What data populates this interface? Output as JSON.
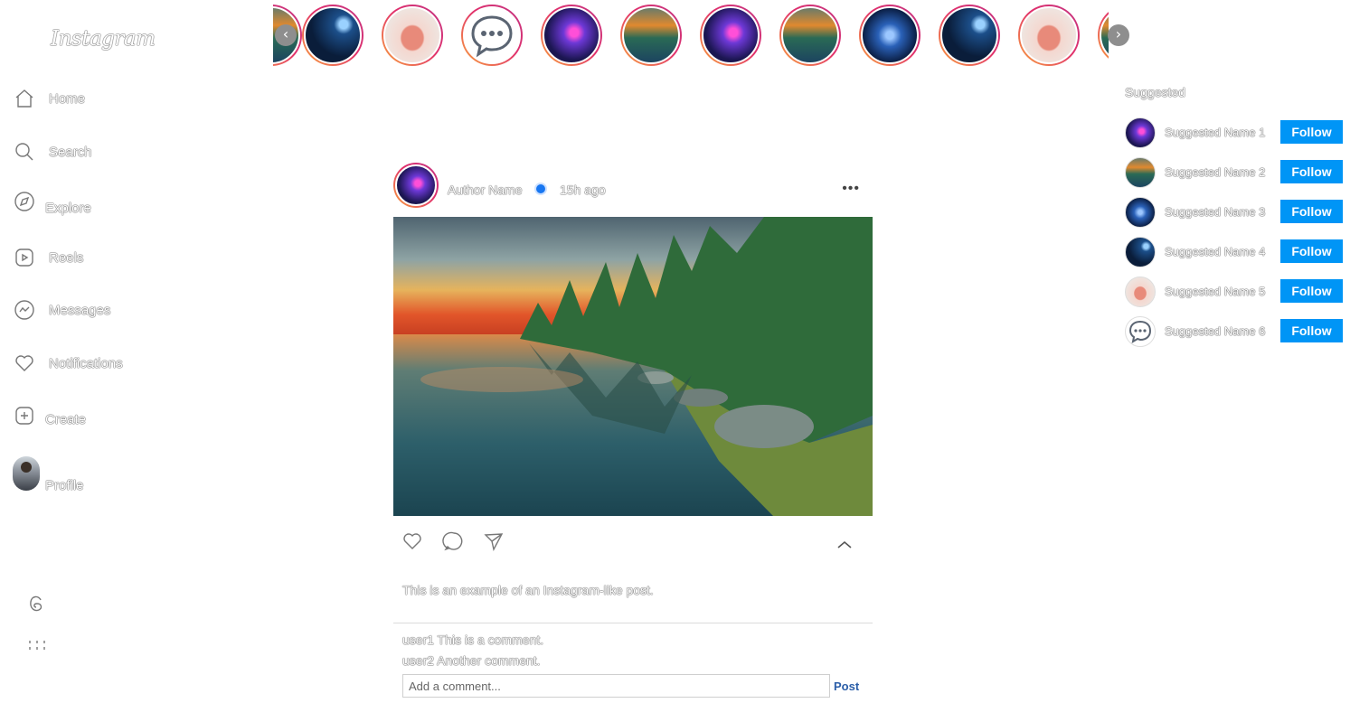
{
  "sidebar": {
    "logo": "Instagram",
    "items": [
      {
        "label": "Home",
        "icon": "home-icon"
      },
      {
        "label": "Search",
        "icon": "search-icon"
      },
      {
        "label": "Explore",
        "icon": "compass-icon"
      },
      {
        "label": "Reels",
        "icon": "reels-icon"
      },
      {
        "label": "Messages",
        "icon": "messenger-icon"
      },
      {
        "label": "Notifications",
        "icon": "heart-icon"
      },
      {
        "label": "Create",
        "icon": "plus-square-icon"
      },
      {
        "label": "Profile",
        "icon": "avatar"
      }
    ],
    "footer_icons": [
      "threads-icon",
      "more-icon"
    ]
  },
  "stories": {
    "prev_arrow": "‹",
    "next_arrow": "›",
    "thumbnails": [
      "night-sky",
      "pink-shoe",
      "chat-bubble",
      "neon-figure",
      "lake-sunset",
      "neon-figure",
      "lake-sunset",
      "blue-figure",
      "night-sky",
      "pink-shoe",
      "lake-sunset"
    ]
  },
  "post": {
    "author": "Author Name",
    "time": "15h ago",
    "more": "•••",
    "caption": "This is an example of an Instagram-like post.",
    "comments": [
      {
        "user": "user1",
        "text": "This is a comment."
      },
      {
        "user": "user2",
        "text": "Another comment."
      }
    ],
    "comment_placeholder": "Add a comment...",
    "post_button": "Post"
  },
  "suggested": {
    "title": "Suggested",
    "follow_label": "Follow",
    "users": [
      {
        "name": "Suggested Name 1"
      },
      {
        "name": "Suggested Name 2"
      },
      {
        "name": "Suggested Name 3"
      },
      {
        "name": "Suggested Name 4"
      },
      {
        "name": "Suggested Name 5"
      },
      {
        "name": "Suggested Name 6"
      }
    ]
  },
  "colors": {
    "follow_button": "#0095f6",
    "story_ring_start": "#f9a43c",
    "story_ring_end": "#c13584",
    "verified_badge": "#1877f2",
    "post_button_text": "#2b5ea8"
  }
}
